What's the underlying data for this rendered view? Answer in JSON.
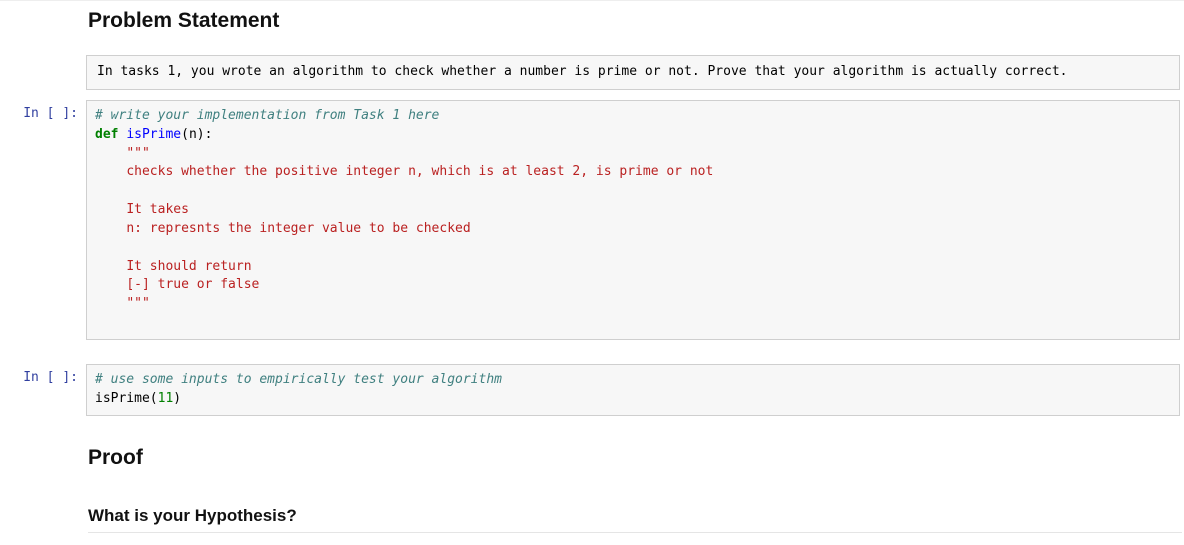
{
  "prompts": {
    "code": "In [ ]:"
  },
  "headings": {
    "problem_statement": "Problem Statement",
    "proof": "Proof",
    "hypothesis": "What is your Hypothesis?"
  },
  "markdown": {
    "problem_text": "In tasks 1, you wrote an algorithm to check whether a number is prime or not. Prove that your algorithm is actually correct."
  },
  "code1": {
    "comment": "# write your implementation from Task 1 here",
    "kw_def": "def",
    "fn_name": "isPrime",
    "paren_open": "(",
    "param": "n",
    "paren_close_colon": "):",
    "docq1": "\"\"\"",
    "doc_l1": "checks whether the positive integer n, which is at least 2, is prime or not",
    "doc_l2": "It takes",
    "doc_l3": "n: represnts the integer value to be checked",
    "doc_l4": "It should return",
    "doc_l5": "[-] true or false",
    "docq2": "\"\"\"",
    "indent4": "    ",
    "indent8": "        "
  },
  "code2": {
    "comment": "# use some inputs to empirically test your algorithm",
    "call_fn": "isPrime",
    "paren_open": "(",
    "arg": "11",
    "paren_close": ")"
  }
}
